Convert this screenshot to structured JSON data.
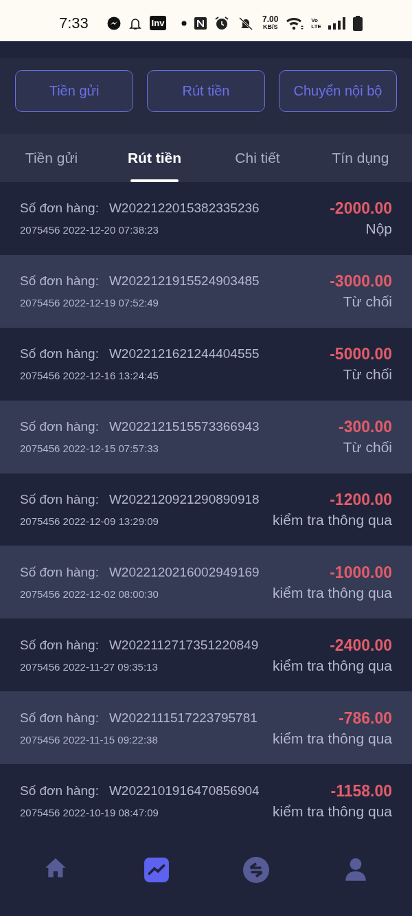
{
  "status_bar": {
    "time": "7:33",
    "app_badge": "Inv",
    "net_speed": "7.00",
    "net_unit": "KB/S",
    "volte_top": "Vo",
    "volte_bottom": "LTE"
  },
  "action_buttons": [
    "Tiền gửi",
    "Rút tiền",
    "Chuyển nội bộ"
  ],
  "tabs": [
    {
      "label": "Tiền gửi",
      "selected": false
    },
    {
      "label": "Rút tiền",
      "selected": true
    },
    {
      "label": "Chi tiết",
      "selected": false
    },
    {
      "label": "Tín dụng",
      "selected": false
    }
  ],
  "records": [
    {
      "order_label": "Số đơn hàng:",
      "order_no": "W2022122015382335236",
      "meta": "2075456 2022-12-20 07:38:23",
      "amount": "-2000.00",
      "status": "Nộp"
    },
    {
      "order_label": "Số đơn hàng:",
      "order_no": "W2022121915524903485",
      "meta": "2075456 2022-12-19 07:52:49",
      "amount": "-3000.00",
      "status": "Từ chối"
    },
    {
      "order_label": "Số đơn hàng:",
      "order_no": "W2022121621244404555",
      "meta": "2075456 2022-12-16 13:24:45",
      "amount": "-5000.00",
      "status": "Từ chối"
    },
    {
      "order_label": "Số đơn hàng:",
      "order_no": "W2022121515573366943",
      "meta": "2075456 2022-12-15 07:57:33",
      "amount": "-300.00",
      "status": "Từ chối"
    },
    {
      "order_label": "Số đơn hàng:",
      "order_no": "W2022120921290890918",
      "meta": "2075456 2022-12-09 13:29:09",
      "amount": "-1200.00",
      "status": "kiểm tra thông qua"
    },
    {
      "order_label": "Số đơn hàng:",
      "order_no": "W2022120216002949169",
      "meta": "2075456 2022-12-02 08:00:30",
      "amount": "-1000.00",
      "status": "kiểm tra thông qua"
    },
    {
      "order_label": "Số đơn hàng:",
      "order_no": "W2022112717351220849",
      "meta": "2075456 2022-11-27 09:35:13",
      "amount": "-2400.00",
      "status": "kiểm tra thông qua"
    },
    {
      "order_label": "Số đơn hàng:",
      "order_no": "W2022111517223795781",
      "meta": "2075456 2022-11-15 09:22:38",
      "amount": "-786.00",
      "status": "kiểm tra thông qua"
    },
    {
      "order_label": "Số đơn hàng:",
      "order_no": "W2022101916470856904",
      "meta": "2075456 2022-10-19 08:47:09",
      "amount": "-1158.00",
      "status": "kiểm tra thông qua"
    }
  ],
  "bottom_nav": [
    {
      "kind": "home",
      "selected": false
    },
    {
      "kind": "chart",
      "selected": true
    },
    {
      "kind": "exchange",
      "selected": false
    },
    {
      "kind": "user",
      "selected": false
    }
  ]
}
